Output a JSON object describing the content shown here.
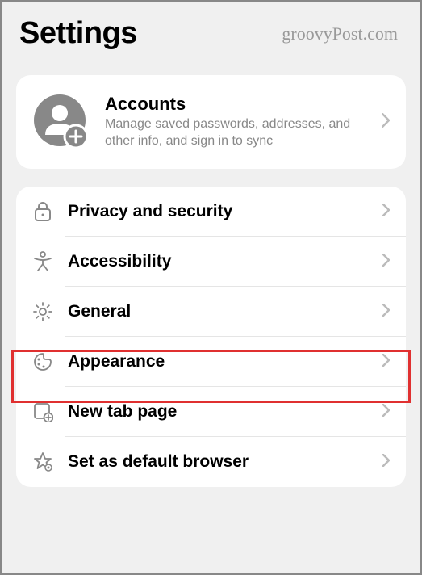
{
  "header": {
    "title": "Settings",
    "watermark": "groovyPost.com"
  },
  "account_card": {
    "title": "Accounts",
    "subtitle": "Manage saved passwords, addresses, and other info, and sign in to sync"
  },
  "menu": {
    "items": [
      {
        "icon": "lock-icon",
        "label": "Privacy and security"
      },
      {
        "icon": "accessibility-icon",
        "label": "Accessibility"
      },
      {
        "icon": "gear-icon",
        "label": "General"
      },
      {
        "icon": "palette-icon",
        "label": "Appearance"
      },
      {
        "icon": "newtab-icon",
        "label": "New tab page"
      },
      {
        "icon": "star-gear-icon",
        "label": "Set as default browser"
      }
    ]
  },
  "highlighted_index": 2
}
